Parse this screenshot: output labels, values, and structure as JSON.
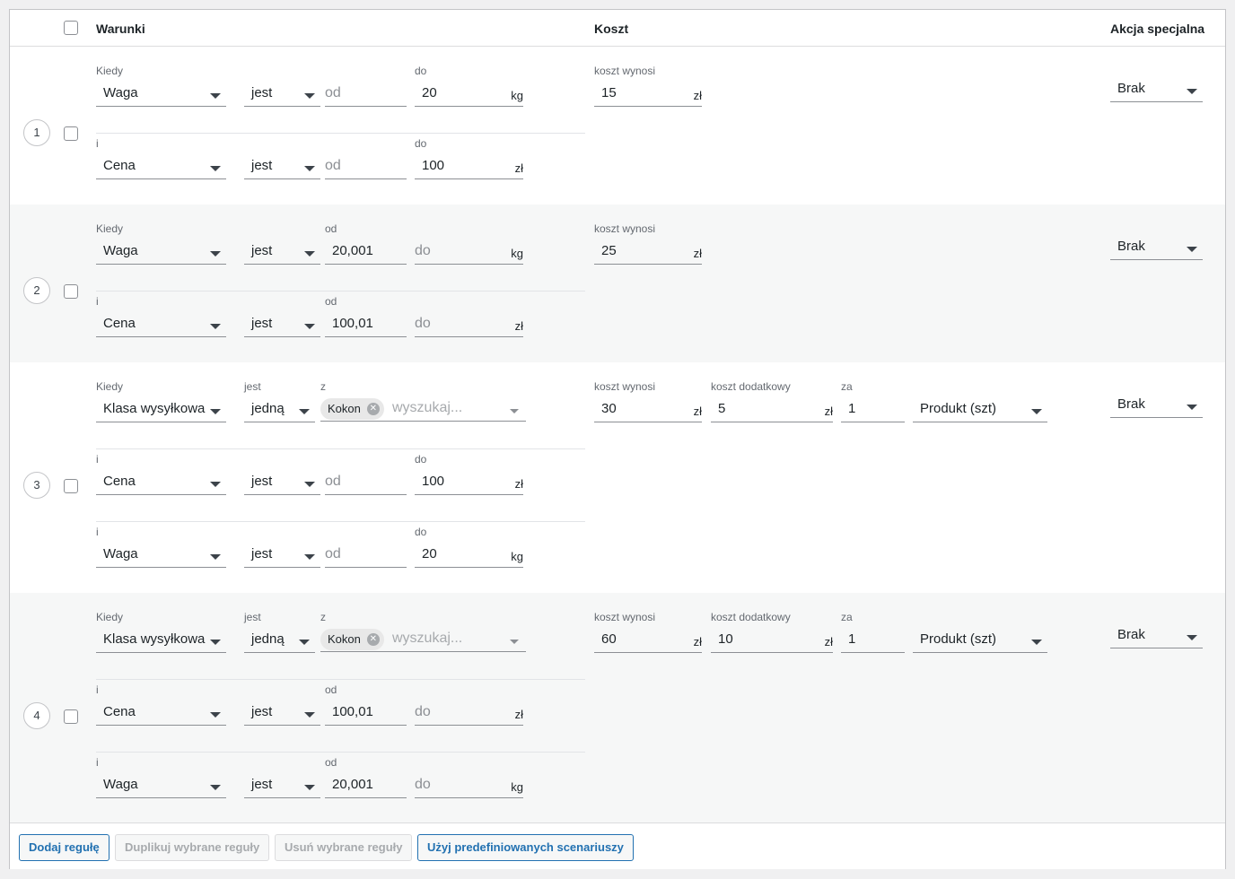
{
  "header": {
    "col_conditions": "Warunki",
    "col_cost": "Koszt",
    "col_special": "Akcja specjalna"
  },
  "labels": {
    "when": "Kiedy",
    "and": "i",
    "from": "od",
    "to": "do",
    "is": "jest",
    "of": "z",
    "cost_is": "koszt wynosi",
    "additional_cost": "koszt dodatkowy",
    "per": "za",
    "search_placeholder": "wyszukaj...",
    "from_placeholder": "od",
    "to_placeholder": "do"
  },
  "units": {
    "kg": "kg",
    "zl": "zł"
  },
  "rules": [
    {
      "number": "1",
      "conditions": [
        {
          "field": "Waga",
          "operator": "jest",
          "from": "",
          "to": "20",
          "unit": "kg"
        },
        {
          "field": "Cena",
          "operator": "jest",
          "from": "",
          "to": "100",
          "unit": "zł"
        }
      ],
      "cost": "15",
      "special_action": "Brak"
    },
    {
      "number": "2",
      "conditions": [
        {
          "field": "Waga",
          "operator": "jest",
          "from": "20,001",
          "to": "",
          "unit": "kg"
        },
        {
          "field": "Cena",
          "operator": "jest",
          "from": "100,01",
          "to": "",
          "unit": "zł"
        }
      ],
      "cost": "25",
      "special_action": "Brak"
    },
    {
      "number": "3",
      "conditions": [
        {
          "field": "Klasa wysyłkowa",
          "operator": "jedną",
          "chip": "Kokon"
        },
        {
          "field": "Cena",
          "operator": "jest",
          "from": "",
          "to": "100",
          "unit": "zł"
        },
        {
          "field": "Waga",
          "operator": "jest",
          "from": "",
          "to": "20",
          "unit": "kg"
        }
      ],
      "cost": "30",
      "additional_cost": "5",
      "per_qty": "1",
      "per_unit": "Produkt (szt)",
      "special_action": "Brak"
    },
    {
      "number": "4",
      "conditions": [
        {
          "field": "Klasa wysyłkowa",
          "operator": "jedną",
          "chip": "Kokon"
        },
        {
          "field": "Cena",
          "operator": "jest",
          "from": "100,01",
          "to": "",
          "unit": "zł"
        },
        {
          "field": "Waga",
          "operator": "jest",
          "from": "20,001",
          "to": "",
          "unit": "kg"
        }
      ],
      "cost": "60",
      "additional_cost": "10",
      "per_qty": "1",
      "per_unit": "Produkt (szt)",
      "special_action": "Brak"
    }
  ],
  "footer": {
    "add_rule": "Dodaj regułę",
    "duplicate_rules": "Duplikuj wybrane reguły",
    "delete_rules": "Usuń wybrane reguły",
    "use_scenarios": "Użyj predefiniowanych scenariuszy"
  }
}
